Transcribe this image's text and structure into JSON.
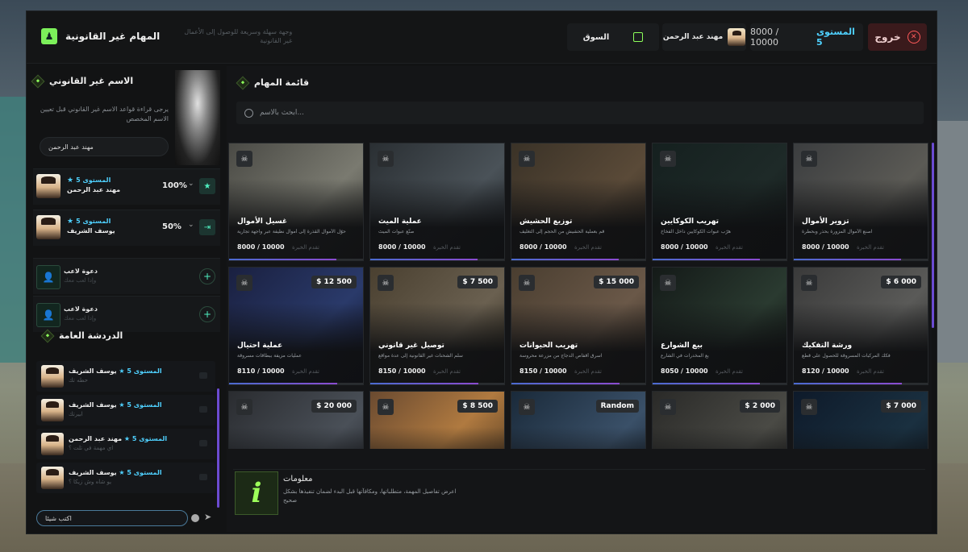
{
  "topbar": {
    "exit_label": "خروج",
    "xp_text": "8000 / 10000",
    "level_text": "المستوى 5",
    "user_name": "مهند عبد الرحمن",
    "market_label": "السوق",
    "brand_name": "المهام غير القانونية",
    "brand_tagline": "وجهة سهلة وسريعة للوصول إلى الأعمال غير القانونية"
  },
  "illegal_name": {
    "title": "الاسم غير القانوني",
    "description": "يرجى قراءة قواعد الاسم غير القانوني قبل تعيين الاسم المخصص",
    "field_value": "مهند عبد الرحمن"
  },
  "members": [
    {
      "level": "المستوى 5",
      "name": "مهند عبد الرحمن",
      "percent": "100%"
    },
    {
      "level": "المستوى 5",
      "name": "يوسف الشريف",
      "percent": "50%"
    }
  ],
  "invites": [
    {
      "title": "دعوة لاعب",
      "subtitle": "وإدا لعب معك"
    },
    {
      "title": "دعوة لاعب",
      "subtitle": "وإدا لعب معك"
    }
  ],
  "chat": {
    "title": "الدردشة العامة",
    "input_value": "اكتب شيئا",
    "messages": [
      {
        "name": "يوسف الشريف",
        "level": "المستوى 5",
        "text": "حطه تك"
      },
      {
        "name": "يوسف الشريف",
        "level": "المستوى 5",
        "text": "ابيرتك"
      },
      {
        "name": "مهند عبد الرحمن",
        "level": "المستوى 5",
        "text": "اي مهمة في تلت ؟"
      },
      {
        "name": "يوسف الشريف",
        "level": "المستوى 5",
        "text": "يو شاه وش زيكا ؟"
      }
    ]
  },
  "missions": {
    "title": "قائمة المهام",
    "search_placeholder": "ابحث بالاسم...",
    "xp_label": "تقدم الخبرة",
    "cards": [
      {
        "title": "تزوير الأموال",
        "desc": "اصنع الأموال المزورة بحذر وبحطرة",
        "xp": "8000 / 10000",
        "price": "",
        "fill": 0.8
      },
      {
        "title": "تهريب الكوكايين",
        "desc": "هرّب عبوات الكوكايين داخل الفخاخ",
        "xp": "8000 / 10000",
        "price": "",
        "fill": 0.8
      },
      {
        "title": "توزيع الحشيش",
        "desc": "قم بعملية الحشيش من الحجم إلى التغليف",
        "xp": "8000 / 10000",
        "price": "",
        "fill": 0.8
      },
      {
        "title": "عملية الميث",
        "desc": "صنّع عبوات الميث",
        "xp": "8000 / 10000",
        "price": "",
        "fill": 0.8
      },
      {
        "title": "غسيل الأموال",
        "desc": "حوّل الأموال القذرة إلى أموال نظيفة عبر واجهة تجارية",
        "xp": "8000 / 10000",
        "price": "",
        "fill": 0.8
      },
      {
        "title": "ورشة التفكيك",
        "desc": "فكك المركبات المسروقة للحصول على قطع",
        "xp": "8120 / 10000",
        "price": "$ 6 000",
        "fill": 0.81
      },
      {
        "title": "بيع الشوارع",
        "desc": "بع المخدرات في الشارع",
        "xp": "8050 / 10000",
        "price": "",
        "fill": 0.8
      },
      {
        "title": "تهريب الحيوانات",
        "desc": "اسرق أقفاص الدجاج من مزرعة محروسة",
        "xp": "8150 / 10000",
        "price": "$ 15 000",
        "fill": 0.81
      },
      {
        "title": "توصيل غير قانوني",
        "desc": "سلّم الشحنات غير القانونية إلى عدة مواقع",
        "xp": "8150 / 10000",
        "price": "$ 7 500",
        "fill": 0.81
      },
      {
        "title": "عملية احتيال",
        "desc": "عمليات مزيفة ببطاقات مسروقة",
        "xp": "8110 / 10000",
        "price": "$ 12 500",
        "fill": 0.81
      },
      {
        "title": "",
        "desc": "",
        "xp": "",
        "price": "$ 7 000",
        "fill": 0
      },
      {
        "title": "",
        "desc": "",
        "xp": "",
        "price": "$ 2 000",
        "fill": 0
      },
      {
        "title": "",
        "desc": "",
        "xp": "",
        "price": "Random",
        "fill": 0
      },
      {
        "title": "",
        "desc": "",
        "xp": "",
        "price": "$ 8 500",
        "fill": 0
      },
      {
        "title": "",
        "desc": "",
        "xp": "",
        "price": "$ 20 000",
        "fill": 0
      }
    ]
  },
  "info": {
    "title": "معلومات",
    "text": "اعرض تفاصيل المهمة، متطلباتها، ومكافآتها قبل البدء لضمان تنفيذها بشكل صحيح"
  },
  "icons": {
    "exit": "close-circle-icon",
    "market": "store-icon",
    "skull": "skull-icon",
    "search": "search-icon",
    "info": "info-icon",
    "invite": "user-plus-icon",
    "send": "send-icon"
  },
  "colors": {
    "accent_green": "#8cff5a",
    "accent_cyan": "#4fd1ff",
    "accent_purple": "#6b4bd0",
    "exit_red": "#ff5a5a"
  }
}
